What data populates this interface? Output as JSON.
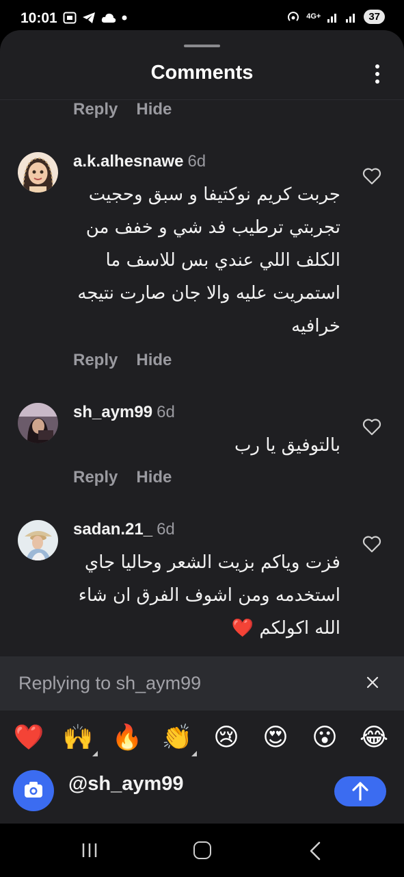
{
  "status_bar": {
    "time": "10:01",
    "network": "4G+",
    "battery": "37"
  },
  "sheet": {
    "title": "Comments"
  },
  "actions": {
    "reply": "Reply",
    "hide": "Hide"
  },
  "comments": [
    {
      "username": "a.k.alhesnawe",
      "time": "6d",
      "text": "جربت كريم نوكتيفا و سبق وحجيت تجربتي ترطيب فد شي و خفف من الكلف اللي عندي بس للاسف ما استمريت عليه والا جان صارت نتيجه خرافيه"
    },
    {
      "username": "sh_aym99",
      "time": "6d",
      "text": "بالتوفيق يا رب"
    },
    {
      "username": "sadan.21_",
      "time": "6d",
      "text": "فزت وياكم بزيت الشعر وحاليا جاي استخدمه ومن اشوف الفرق ان شاء الله اكولكم ❤️"
    }
  ],
  "reply_bar": {
    "text": "Replying to sh_aym99"
  },
  "emojis": [
    "❤️",
    "🙌",
    "🔥",
    "👏",
    "😢",
    "😍",
    "😮",
    "😂"
  ],
  "composer": {
    "value": "@sh_aym99"
  },
  "colors": {
    "sheet_bg": "#1f1f22",
    "accent": "#3b6cf1",
    "muted_text": "#9a9aa0"
  }
}
